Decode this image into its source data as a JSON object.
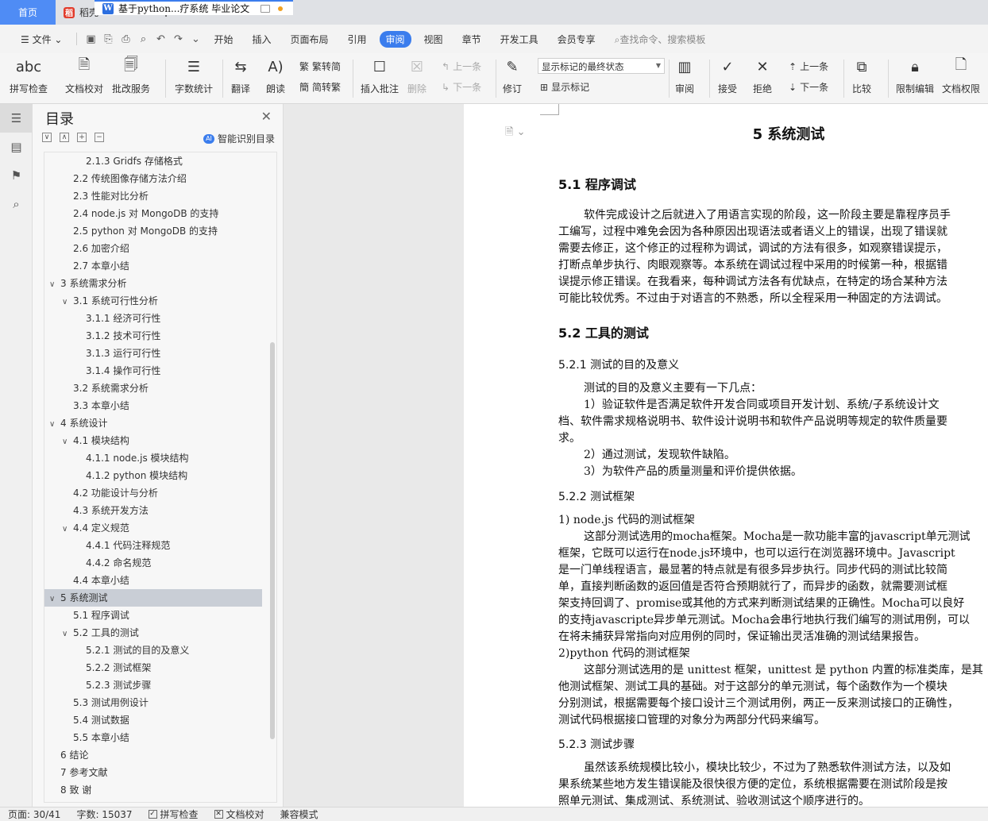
{
  "tabs": [
    {
      "label": "首页"
    },
    {
      "label": "稻壳"
    },
    {
      "label": "基于python...疗系统 毕业论文"
    }
  ],
  "menu": {
    "file": "文件",
    "items": [
      "开始",
      "插入",
      "页面布局",
      "引用",
      "审阅",
      "视图",
      "章节",
      "开发工具",
      "会员专享"
    ],
    "active": "审阅",
    "search_placeholder": "查找命令、搜索模板"
  },
  "ribbon": {
    "spell_check": "拼写检查",
    "doc_proof": "文档校对",
    "batch_service": "批改服务",
    "word_count": "字数统计",
    "translate": "翻译",
    "read_aloud": "朗读",
    "to_traditional": "繁转简",
    "to_simplified": "简转繁",
    "insert_comment": "插入批注",
    "delete": "删除",
    "prev_comment": "上一条",
    "next_comment": "下一条",
    "track_changes": "修订",
    "markup_select": "显示标记的最终状态",
    "show_markup": "显示标记",
    "review": "审阅",
    "accept": "接受",
    "reject": "拒绝",
    "prev_change": "上一条",
    "next_change": "下一条",
    "compare": "比较",
    "restrict_editing": "限制编辑",
    "doc_permission": "文档权限"
  },
  "toc": {
    "title": "目录",
    "smart_label": "智能识别目录",
    "items": [
      {
        "text": "2.1.3 Gridfs 存储格式",
        "level": 3,
        "caret": ""
      },
      {
        "text": "2.2  传统图像存储方法介绍",
        "level": 2,
        "caret": ""
      },
      {
        "text": "2.3  性能对比分析",
        "level": 2,
        "caret": ""
      },
      {
        "text": "2.4 node.js 对 MongoDB 的支持",
        "level": 2,
        "caret": ""
      },
      {
        "text": "2.5 python 对 MongoDB 的支持",
        "level": 2,
        "caret": ""
      },
      {
        "text": "2.6  加密介绍",
        "level": 2,
        "caret": ""
      },
      {
        "text": "2.7  本章小结",
        "level": 2,
        "caret": ""
      },
      {
        "text": "3  系统需求分析",
        "level": 1,
        "caret": "∨"
      },
      {
        "text": "3.1  系统可行性分析",
        "level": 2,
        "caret": "∨"
      },
      {
        "text": "3.1.1  经济可行性",
        "level": 3,
        "caret": ""
      },
      {
        "text": "3.1.2  技术可行性",
        "level": 3,
        "caret": ""
      },
      {
        "text": "3.1.3  运行可行性",
        "level": 3,
        "caret": ""
      },
      {
        "text": "3.1.4  操作可行性",
        "level": 3,
        "caret": ""
      },
      {
        "text": "3.2  系统需求分析",
        "level": 2,
        "caret": ""
      },
      {
        "text": "3.3  本章小结",
        "level": 2,
        "caret": ""
      },
      {
        "text": "4  系统设计",
        "level": 1,
        "caret": "∨"
      },
      {
        "text": "4.1  模块结构",
        "level": 2,
        "caret": "∨"
      },
      {
        "text": "4.1.1 node.js 模块结构",
        "level": 3,
        "caret": ""
      },
      {
        "text": "4.1.2 python 模块结构",
        "level": 3,
        "caret": ""
      },
      {
        "text": "4.2 功能设计与分析",
        "level": 2,
        "caret": ""
      },
      {
        "text": "4.3  系统开发方法",
        "level": 2,
        "caret": ""
      },
      {
        "text": "4.4  定义规范",
        "level": 2,
        "caret": "∨"
      },
      {
        "text": "4.4.1  代码注释规范",
        "level": 3,
        "caret": ""
      },
      {
        "text": "4.4.2  命名规范",
        "level": 3,
        "caret": ""
      },
      {
        "text": "4.4  本章小结",
        "level": 2,
        "caret": ""
      },
      {
        "text": "5  系统测试",
        "level": 1,
        "caret": "∨",
        "selected": true
      },
      {
        "text": "5.1  程序调试",
        "level": 2,
        "caret": ""
      },
      {
        "text": "5.2  工具的测试",
        "level": 2,
        "caret": "∨"
      },
      {
        "text": "5.2.1  测试的目的及意义",
        "level": 3,
        "caret": ""
      },
      {
        "text": "5.2.2  测试框架",
        "level": 3,
        "caret": ""
      },
      {
        "text": "5.2.3  测试步骤",
        "level": 3,
        "caret": ""
      },
      {
        "text": "5.3  测试用例设计",
        "level": 2,
        "caret": ""
      },
      {
        "text": "5.4  测试数据",
        "level": 2,
        "caret": ""
      },
      {
        "text": "5.5  本章小结",
        "level": 2,
        "caret": ""
      },
      {
        "text": "6  结论",
        "level": 1,
        "caret": ""
      },
      {
        "text": "7  参考文献",
        "level": 1,
        "caret": ""
      },
      {
        "text": "8  致  谢",
        "level": 1,
        "caret": ""
      }
    ]
  },
  "document": {
    "chapter_title": "5  系统测试",
    "s51_title": "5.1  程序调试",
    "s51_lines": [
      "软件完成设计之后就进入了用语言实现的阶段，这一阶段主要是靠程序员手",
      "工编写，过程中难免会因为各种原因出现语法或者语义上的错误，出现了错误就",
      "需要去修正，这个修正的过程称为调试，调试的方法有很多，如观察错误提示，",
      "打断点单步执行、肉眼观察等。本系统在调试过程中采用的时候第一种，根据错",
      "误提示修正错误。在我看来，每种调试方法各有优缺点，在特定的场合某种方法",
      "可能比较优秀。不过由于对语言的不熟悉，所以全程采用一种固定的方法调试。"
    ],
    "s52_title": "5.2  工具的测试",
    "s521_title": "5.2.1  测试的目的及意义",
    "s521_lines": [
      "测试的目的及意义主要有一下几点：",
      "1）验证软件是否满足软件开发合同或项目开发计划、系统/子系统设计文",
      "档、软件需求规格说明书、软件设计说明书和软件产品说明等规定的软件质量要",
      "求。",
      "2）通过测试，发现软件缺陷。",
      "3）为软件产品的质量测量和评价提供依据。"
    ],
    "s522_title": "5.2.2  测试框架",
    "s522_lines": [
      "1)  node.js 代码的测试框架",
      "这部分测试选用的mocha框架。Mocha是一款功能丰富的javascript单元测试",
      "框架，它既可以运行在node.js环境中，也可以运行在浏览器环境中。Javascript",
      "是一门单线程语言，最显著的特点就是有很多异步执行。同步代码的测试比较简",
      "单，直接判断函数的返回值是否符合预期就行了，而异步的函数，就需要测试框",
      "架支持回调了、promise或其他的方式来判断测试结果的正确性。Mocha可以良好",
      "的支持javascripte异步单元测试。Mocha会串行地执行我们编写的测试用例，可以",
      "在将未捕获异常指向对应用例的同时，保证输出灵活准确的测试结果报告。",
      "2)python 代码的测试框架",
      "这部分测试选用的是 unittest 框架，unittest 是 python 内置的标准类库，是其",
      "他测试框架、测试工具的基础。对于这部分的单元测试，每个函数作为一个模块",
      "分别测试，根据需要每个接口设计三个测试用例，两正一反来测试接口的正确性，",
      "测试代码根据接口管理的对象分为两部分代码来编写。"
    ],
    "s523_title": "5.2.3  测试步骤",
    "s523_lines": [
      "虽然该系统规模比较小，模块比较少，不过为了熟悉软件测试方法，以及如",
      "果系统某些地方发生错误能及很快很方便的定位，系统根据需要在测试阶段是按",
      "照单元测试、集成测试、系统测试、验收测试这个顺序进行的。"
    ]
  },
  "status": {
    "page": "页面: 30/41",
    "words": "字数: 15037",
    "spell_check": "拼写检查",
    "doc_proof": "文档校对",
    "compat_mode": "兼容模式"
  }
}
